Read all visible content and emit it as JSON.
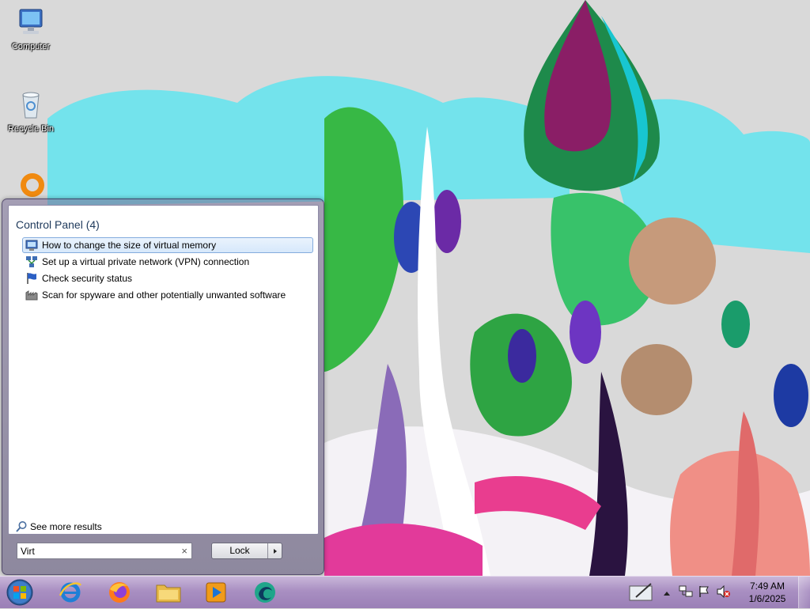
{
  "desktop": {
    "icons": [
      {
        "label": "Computer",
        "icon": "computer-icon"
      },
      {
        "label": "Recycle Bin",
        "icon": "recycle-bin-icon"
      },
      {
        "label": "",
        "icon": "app-ring-icon"
      }
    ]
  },
  "start_menu": {
    "results_heading": "Control Panel (4)",
    "results": [
      {
        "label": "How to change the size of virtual memory",
        "icon": "system-icon",
        "selected": true
      },
      {
        "label": "Set up a virtual private network (VPN) connection",
        "icon": "network-icon",
        "selected": false
      },
      {
        "label": "Check security status",
        "icon": "security-flag-icon",
        "selected": false
      },
      {
        "label": "Scan for spyware and other potentially unwanted software",
        "icon": "defender-icon",
        "selected": false
      }
    ],
    "see_more": "See more results",
    "search": {
      "value": "Virt",
      "clear_glyph": "×"
    },
    "lock_label": "Lock"
  },
  "taskbar": {
    "pinned": [
      {
        "name": "internet-explorer",
        "icon": "internet-explorer-icon"
      },
      {
        "name": "firefox",
        "icon": "firefox-icon"
      },
      {
        "name": "file-explorer",
        "icon": "folder-icon"
      },
      {
        "name": "media-player",
        "icon": "media-player-icon"
      },
      {
        "name": "app",
        "icon": "app-swirl-icon"
      }
    ],
    "tray": {
      "time": "7:49 AM",
      "date": "1/6/2025"
    }
  },
  "colors": {
    "selected_bg": "#d6e8fb",
    "selected_border": "#84acdd",
    "taskbar": "#a98fc2"
  }
}
